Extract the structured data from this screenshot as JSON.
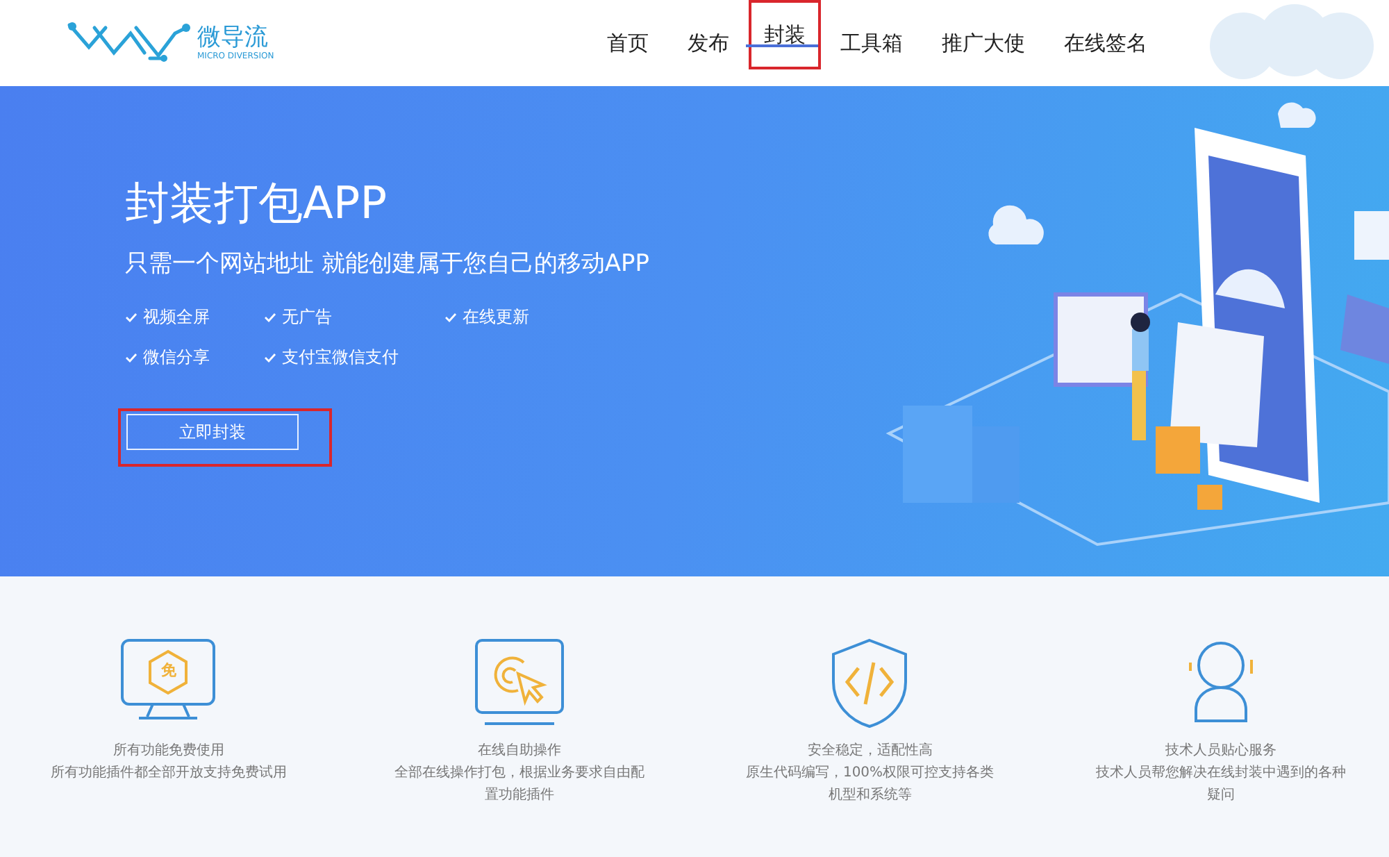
{
  "header": {
    "logo": {
      "name": "微导流",
      "tagline": "MICRO DIVERSION"
    },
    "nav": [
      {
        "label": "首页",
        "selected": false,
        "highlighted": false
      },
      {
        "label": "发布",
        "selected": false,
        "highlighted": false
      },
      {
        "label": "封装",
        "selected": true,
        "highlighted": true
      },
      {
        "label": "工具箱",
        "selected": false,
        "highlighted": false
      },
      {
        "label": "推广大使",
        "selected": false,
        "highlighted": false
      },
      {
        "label": "在线签名",
        "selected": false,
        "highlighted": false
      }
    ]
  },
  "hero": {
    "title": "封装打包APP",
    "subtitle": "只需一个网站地址 就能创建属于您自己的移动APP",
    "features": [
      [
        "视频全屏",
        "无广告",
        "在线更新"
      ],
      [
        "微信分享",
        "支付宝微信支付"
      ]
    ],
    "cta": {
      "label": "立即封装",
      "highlighted": true
    },
    "illustration": {
      "kind": "picture"
    }
  },
  "features": [
    {
      "kind": "monitor",
      "icon_text": "免",
      "title": "所有功能免费使用",
      "description": "所有功能插件都全部开放支持免费试用"
    },
    {
      "kind": "click",
      "title": "在线自助操作",
      "description": "全部在线操作打包，根据业务要求自由配置功能插件"
    },
    {
      "kind": "shield",
      "title": "安全稳定，适配性高",
      "description": "原生代码编写，100%权限可控支持各类机型和系统等"
    },
    {
      "kind": "support",
      "title": "技术人员贴心服务",
      "description": "技术人员帮您解决在线封装中遇到的各种疑问"
    }
  ]
}
